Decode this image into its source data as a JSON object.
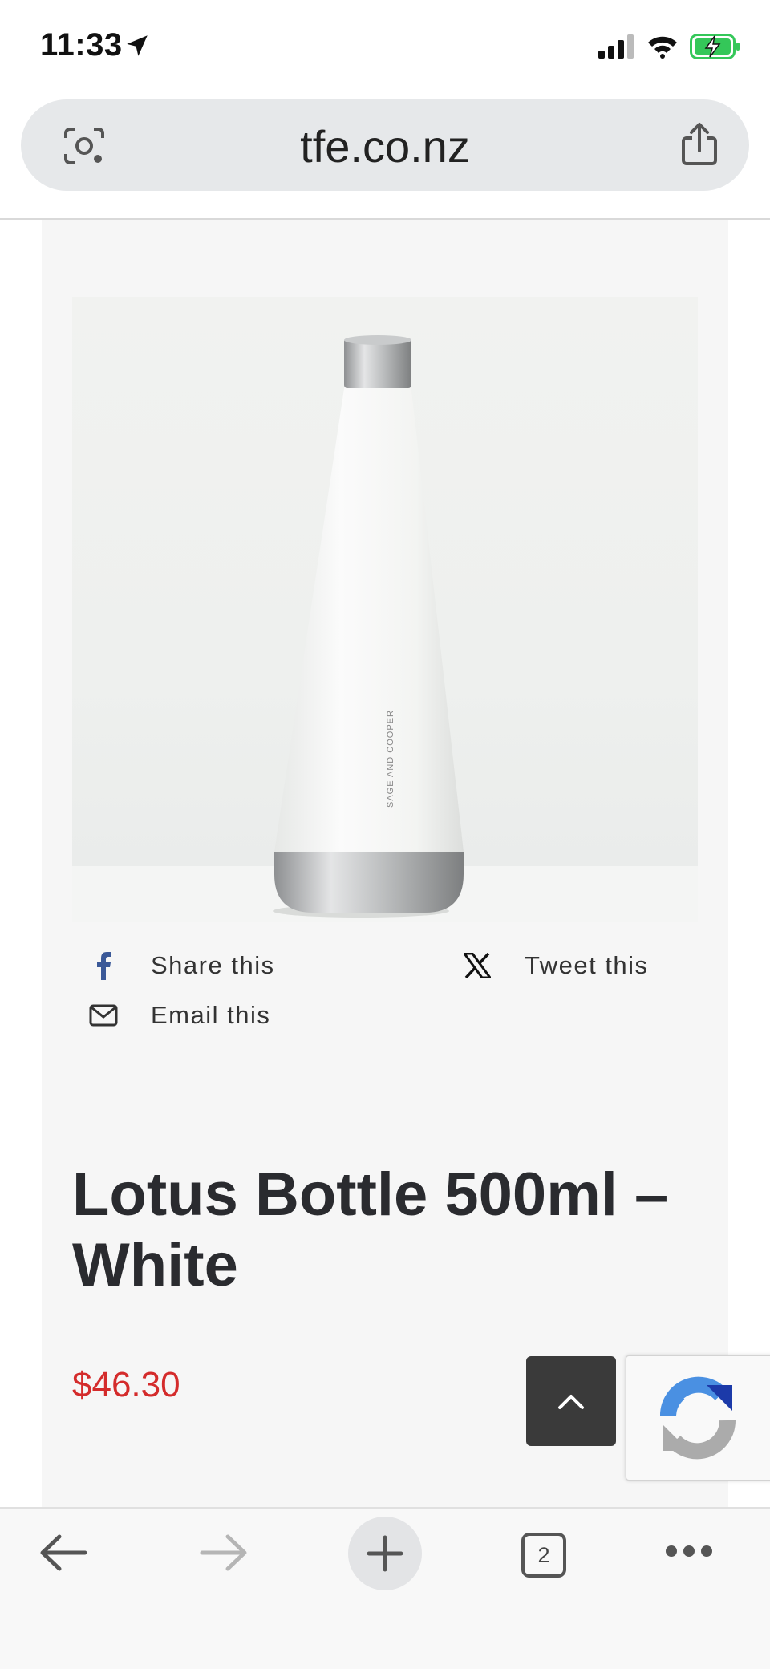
{
  "status_bar": {
    "time": "11:33",
    "icons": [
      "location-arrow-icon",
      "signal-icon",
      "wifi-icon",
      "battery-charging-icon"
    ]
  },
  "browser": {
    "url": "tfe.co.nz",
    "tab_count": "2",
    "accent_colors": {
      "battery": "#34c759",
      "toolbar_icon": "#555555",
      "forward_disabled": "#b5b5b5"
    }
  },
  "product": {
    "image_brand_text": "SAGE AND COOPER",
    "share": {
      "facebook_label": "Share this",
      "twitter_label": "Tweet this",
      "email_label": "Email this"
    },
    "title": "Lotus Bottle 500ml – White",
    "price": "$46.30",
    "price_color": "#d42b2b"
  }
}
